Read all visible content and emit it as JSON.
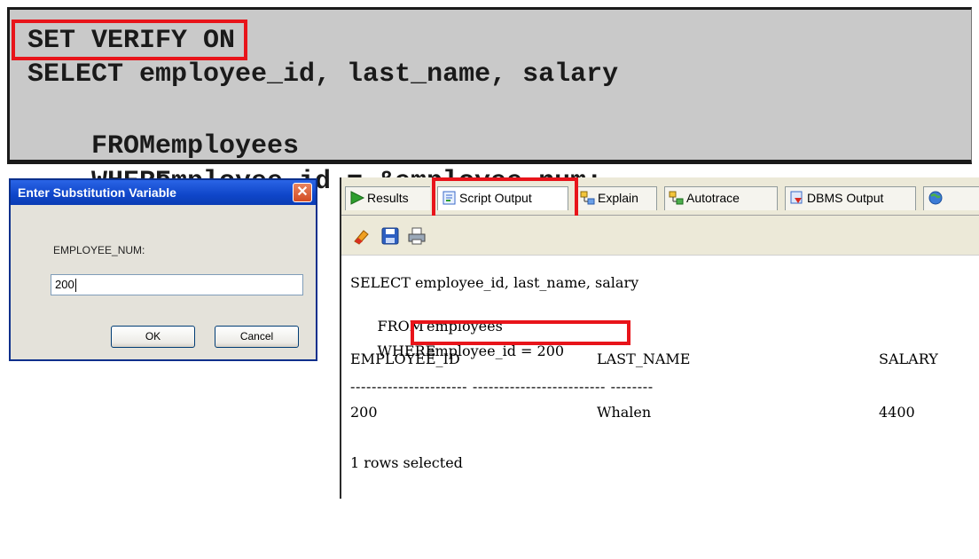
{
  "code": {
    "line1": "SET VERIFY ON",
    "line2": "SELECT employee_id, last_name, salary",
    "line3_kw": "FROM",
    "line3_rest": "employees",
    "line4_kw": "WHERE",
    "line4_rest": "employee_id = &employee_num;"
  },
  "dialog": {
    "title": "Enter Substitution Variable",
    "close_glyph": "✕",
    "label": "EMPLOYEE_NUM:",
    "input_value": "200",
    "ok_label": "OK",
    "cancel_label": "Cancel"
  },
  "tabs": [
    {
      "label": "Results",
      "icon": "play-icon"
    },
    {
      "label": "Script Output",
      "icon": "script-icon"
    },
    {
      "label": "Explain",
      "icon": "explain-icon"
    },
    {
      "label": "Autotrace",
      "icon": "autotrace-icon"
    },
    {
      "label": "DBMS Output",
      "icon": "dbms-output-icon"
    }
  ],
  "toolbar": {
    "icons": [
      "eraser-icon",
      "save-icon",
      "print-icon"
    ]
  },
  "output": {
    "line1": "SELECT employee_id, last_name, salary",
    "line2_kw": "FROM",
    "line2_rest": "employees",
    "line3_kw": "WHERE",
    "line3_rest": "employee_id = 200",
    "headers": [
      "EMPLOYEE_ID",
      "LAST_NAME",
      "SALARY"
    ],
    "separator": "---------------------- ------------------------- --------",
    "row": [
      "200",
      "Whalen",
      "4400"
    ],
    "footer": "1 rows selected"
  },
  "colors": {
    "highlight": "#e8141a",
    "code_bg": "#c9c9c9",
    "titlebar": "#0f46c9"
  }
}
